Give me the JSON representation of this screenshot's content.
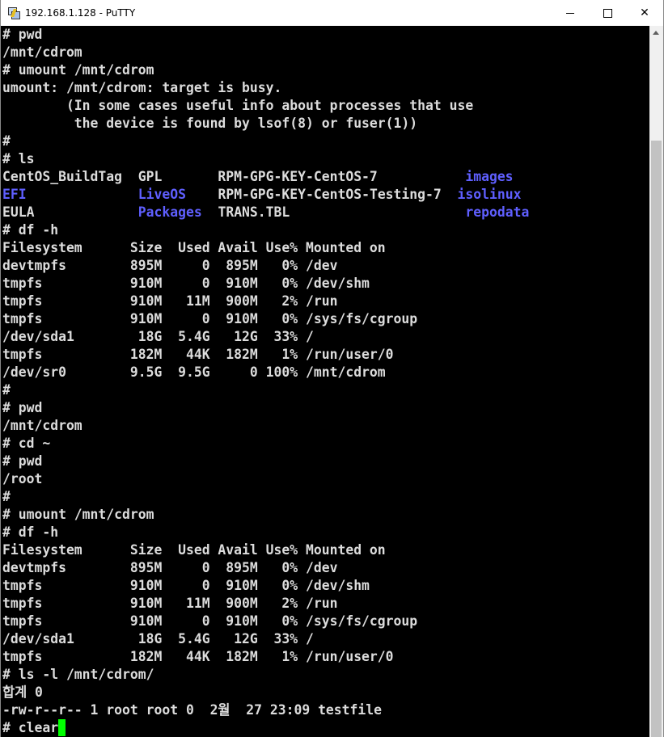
{
  "window": {
    "title": "192.168.1.128 - PuTTY",
    "controls": {
      "minimize_icon": "minimize-icon",
      "maximize_icon": "maximize-icon",
      "close_label": "✕"
    }
  },
  "colors": {
    "terminal_bg": "#000000",
    "terminal_fg": "#dcdcdc",
    "directory_blue": "#5f5fff",
    "cursor": "#00ff00"
  },
  "terminal": {
    "lines": [
      [
        {
          "t": "# pwd"
        }
      ],
      [
        {
          "t": "/mnt/cdrom"
        }
      ],
      [
        {
          "t": "# umount /mnt/cdrom"
        }
      ],
      [
        {
          "t": "umount: /mnt/cdrom: target is busy."
        }
      ],
      [
        {
          "t": "        (In some cases useful info about processes that use"
        }
      ],
      [
        {
          "t": "         the device is found by lsof(8) or fuser(1))"
        }
      ],
      [
        {
          "t": "#"
        }
      ],
      [
        {
          "t": "# ls"
        }
      ],
      [
        {
          "t": "CentOS_BuildTag  GPL       RPM-GPG-KEY-CentOS-7           "
        },
        {
          "t": "images",
          "c": "blue"
        }
      ],
      [
        {
          "t": "EFI",
          "c": "blue"
        },
        {
          "t": "              "
        },
        {
          "t": "LiveOS",
          "c": "blue"
        },
        {
          "t": "    RPM-GPG-KEY-CentOS-Testing-7  "
        },
        {
          "t": "isolinux",
          "c": "blue"
        }
      ],
      [
        {
          "t": "EULA             "
        },
        {
          "t": "Packages",
          "c": "blue"
        },
        {
          "t": "  TRANS.TBL                      "
        },
        {
          "t": "repodata",
          "c": "blue"
        }
      ],
      [
        {
          "t": "# df -h"
        }
      ],
      [
        {
          "t": "Filesystem      Size  Used Avail Use% Mounted on"
        }
      ],
      [
        {
          "t": "devtmpfs        895M     0  895M   0% /dev"
        }
      ],
      [
        {
          "t": "tmpfs           910M     0  910M   0% /dev/shm"
        }
      ],
      [
        {
          "t": "tmpfs           910M   11M  900M   2% /run"
        }
      ],
      [
        {
          "t": "tmpfs           910M     0  910M   0% /sys/fs/cgroup"
        }
      ],
      [
        {
          "t": "/dev/sda1        18G  5.4G   12G  33% /"
        }
      ],
      [
        {
          "t": "tmpfs           182M   44K  182M   1% /run/user/0"
        }
      ],
      [
        {
          "t": "/dev/sr0        9.5G  9.5G     0 100% /mnt/cdrom"
        }
      ],
      [
        {
          "t": "#"
        }
      ],
      [
        {
          "t": "# pwd"
        }
      ],
      [
        {
          "t": "/mnt/cdrom"
        }
      ],
      [
        {
          "t": "# cd ~"
        }
      ],
      [
        {
          "t": "# pwd"
        }
      ],
      [
        {
          "t": "/root"
        }
      ],
      [
        {
          "t": "#"
        }
      ],
      [
        {
          "t": "# umount /mnt/cdrom"
        }
      ],
      [
        {
          "t": "# df -h"
        }
      ],
      [
        {
          "t": "Filesystem      Size  Used Avail Use% Mounted on"
        }
      ],
      [
        {
          "t": "devtmpfs        895M     0  895M   0% /dev"
        }
      ],
      [
        {
          "t": "tmpfs           910M     0  910M   0% /dev/shm"
        }
      ],
      [
        {
          "t": "tmpfs           910M   11M  900M   2% /run"
        }
      ],
      [
        {
          "t": "tmpfs           910M     0  910M   0% /sys/fs/cgroup"
        }
      ],
      [
        {
          "t": "/dev/sda1        18G  5.4G   12G  33% /"
        }
      ],
      [
        {
          "t": "tmpfs           182M   44K  182M   1% /run/user/0"
        }
      ],
      [
        {
          "t": "# ls -l /mnt/cdrom/"
        }
      ],
      [
        {
          "t": "합계 0"
        }
      ],
      [
        {
          "t": "-rw-r--r-- 1 root root 0  2월  27 23:09 testfile"
        }
      ],
      [
        {
          "t": "# clear"
        },
        {
          "cursor": true
        }
      ]
    ]
  }
}
